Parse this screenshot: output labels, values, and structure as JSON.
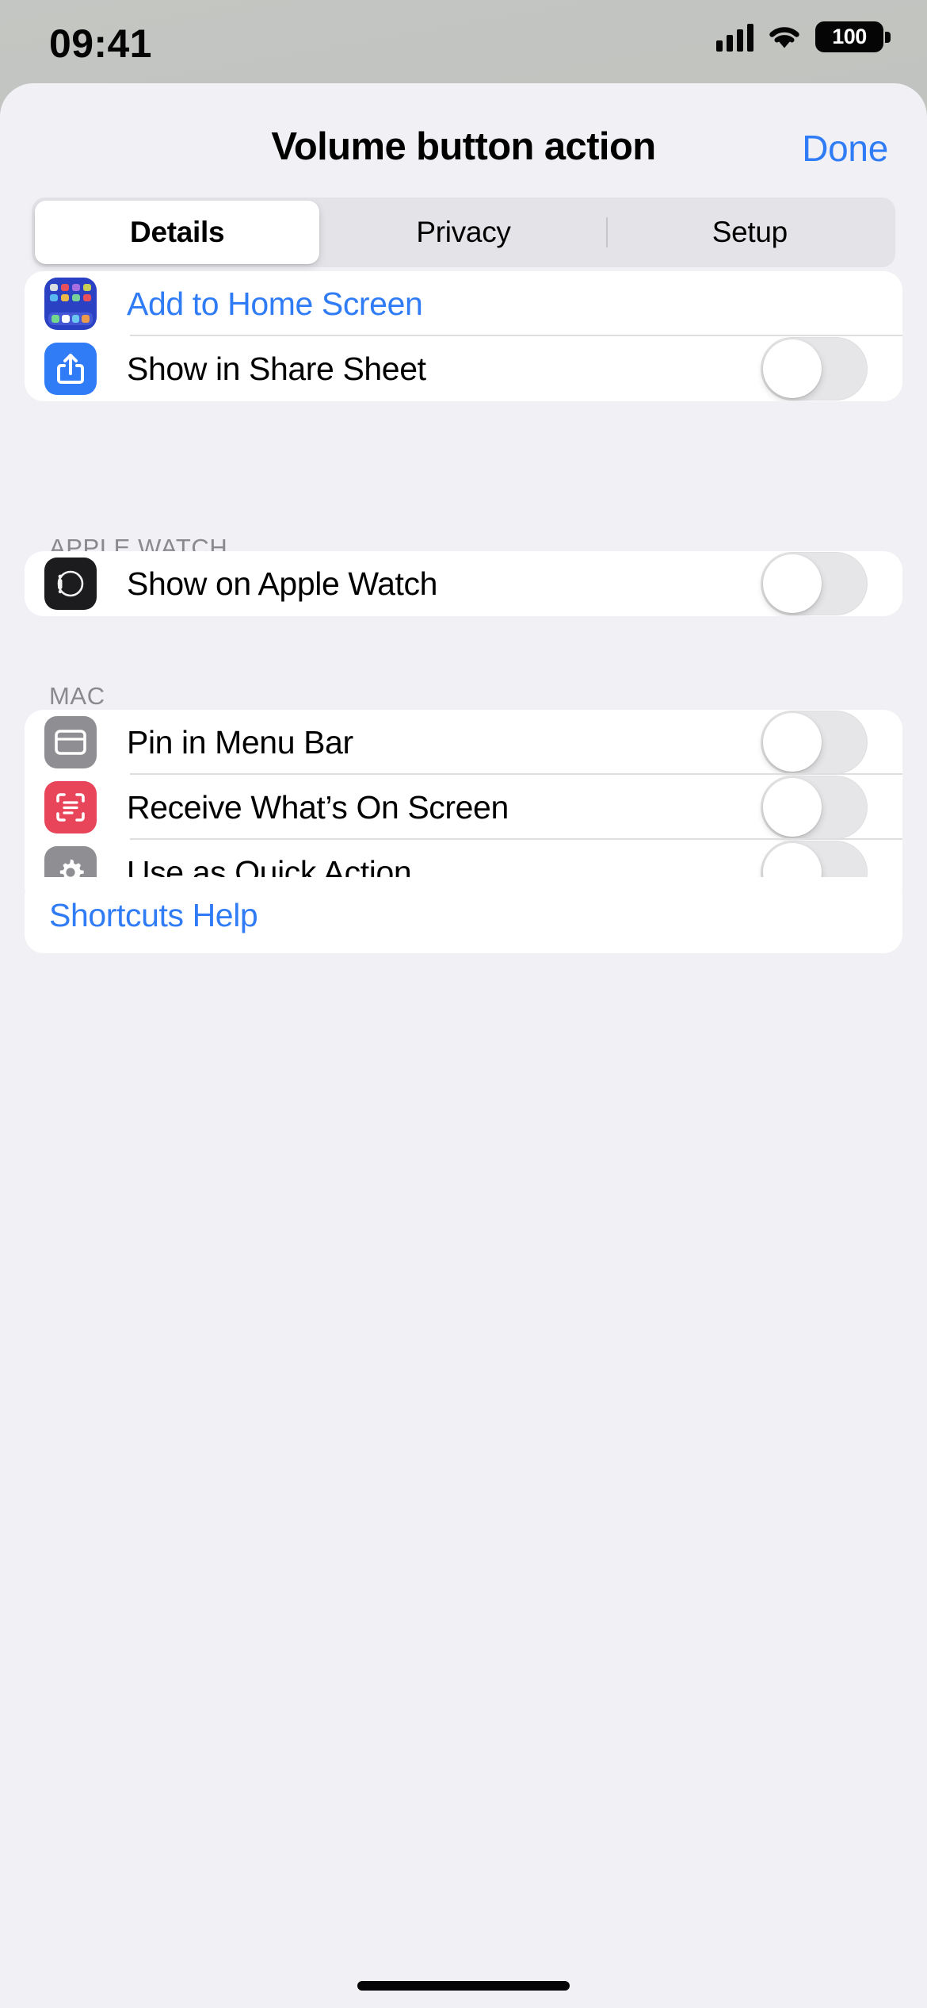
{
  "status_bar": {
    "time": "09:41",
    "signal_icon": "cellular-bars-icon",
    "wifi_icon": "wifi-icon",
    "battery_level": "100"
  },
  "header": {
    "title": "Volume button action",
    "done_label": "Done"
  },
  "segmented_control": {
    "selected": "Details",
    "tabs": [
      {
        "label": "Details"
      },
      {
        "label": "Privacy"
      },
      {
        "label": "Setup"
      }
    ]
  },
  "sections": [
    {
      "id": "general",
      "header": "",
      "rows": [
        {
          "id": "add-to-home-screen",
          "label": "Add to Home Screen",
          "icon": "home-screen-grid-icon",
          "style": "link",
          "control": "none"
        },
        {
          "id": "show-in-share-sheet",
          "label": "Show in Share Sheet",
          "icon": "share-sheet-icon",
          "style": "plain",
          "control": "toggle",
          "toggle_on": false
        }
      ]
    },
    {
      "id": "apple-watch",
      "header": "APPLE WATCH",
      "rows": [
        {
          "id": "show-on-apple-watch",
          "label": "Show on Apple Watch",
          "icon": "apple-watch-icon",
          "style": "plain",
          "control": "toggle",
          "toggle_on": false
        }
      ]
    },
    {
      "id": "mac",
      "header": "MAC",
      "rows": [
        {
          "id": "pin-in-menu-bar",
          "label": "Pin in Menu Bar",
          "icon": "menu-bar-window-icon",
          "style": "plain",
          "control": "toggle",
          "toggle_on": false
        },
        {
          "id": "receive-whats-on-screen",
          "label": "Receive What’s On Screen",
          "icon": "screen-scan-icon",
          "style": "plain",
          "control": "toggle",
          "toggle_on": false
        },
        {
          "id": "use-as-quick-action",
          "label": "Use as Quick Action",
          "icon": "gear-icon",
          "style": "plain",
          "control": "toggle",
          "toggle_on": false
        }
      ]
    }
  ],
  "help": {
    "label": "Shortcuts Help"
  },
  "colors": {
    "accent_blue": "#2f7cf6",
    "sheet_background": "#f1f1f5",
    "card_background": "#ffffff",
    "section_header_text": "#8a8a8e",
    "toggle_off_track": "#e6e6e8",
    "icon_home": "#2b41c4",
    "icon_share": "#2f7cf6",
    "icon_watch": "#1c1c1e",
    "icon_gray": "#8e8e93",
    "icon_red": "#e8455a"
  }
}
